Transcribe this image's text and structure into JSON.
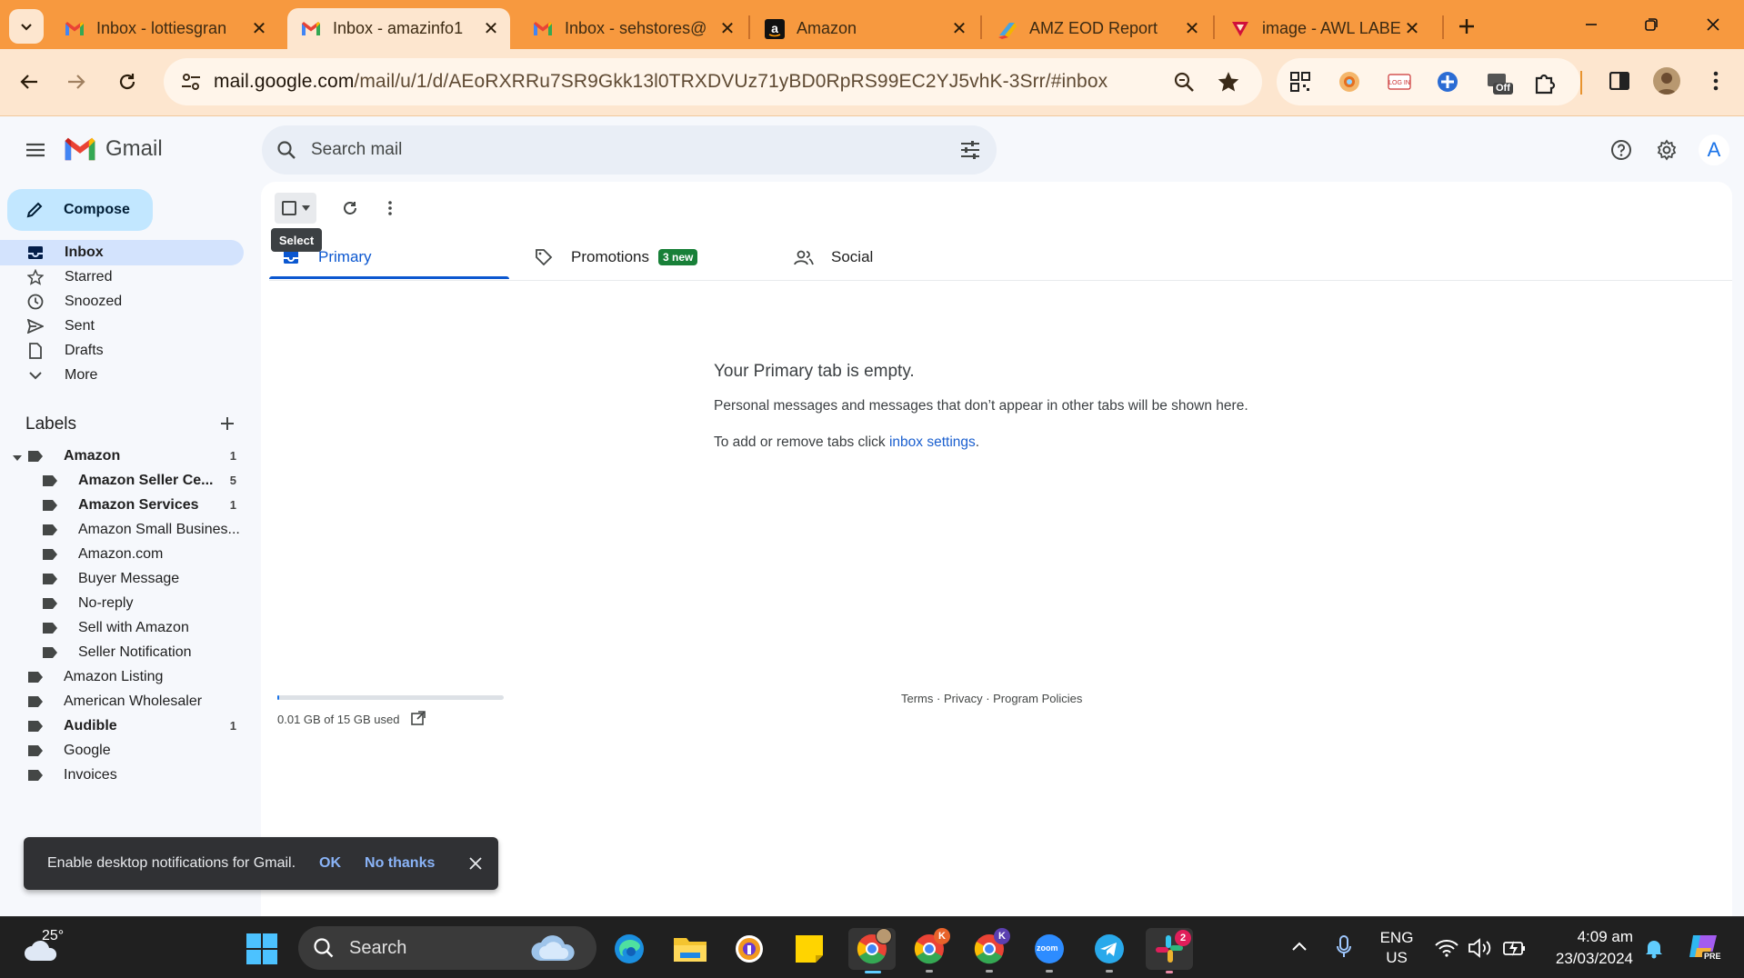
{
  "browser": {
    "tabs": [
      {
        "title": "Inbox - lottiesgran",
        "favicon": "gmail-icon"
      },
      {
        "title": "Inbox - amazinfo1",
        "favicon": "gmail-icon",
        "active": true
      },
      {
        "title": "Inbox - sehstores@",
        "favicon": "gmail-icon"
      },
      {
        "title": "Amazon",
        "favicon": "amazon-icon"
      },
      {
        "title": "AMZ EOD Report",
        "favicon": "report-icon"
      },
      {
        "title": "image - AWL LABE",
        "favicon": "image-icon"
      }
    ],
    "url_host": "mail.google.com",
    "url_path": "/mail/u/1/d/AEoRXRRu7SR9Gkk13l0TRXDVUz71yBD0RpRS99EC2YJ5vhK-3Srr/#inbox",
    "ext_badge": "Off",
    "accent_color": "#f7993f"
  },
  "gmail": {
    "logo_text": "Gmail",
    "search_placeholder": "Search mail",
    "compose_label": "Compose",
    "avatar_initial": "A",
    "nav": [
      {
        "label": "Inbox",
        "icon": "inbox-icon"
      },
      {
        "label": "Starred",
        "icon": "star-icon"
      },
      {
        "label": "Snoozed",
        "icon": "clock-icon"
      },
      {
        "label": "Sent",
        "icon": "send-icon"
      },
      {
        "label": "Drafts",
        "icon": "draft-icon"
      },
      {
        "label": "More",
        "icon": "chevron-down-icon"
      }
    ],
    "labels_heading": "Labels",
    "labels": [
      {
        "name": "Amazon",
        "count": "1",
        "bold": true,
        "indent": 0
      },
      {
        "name": "Amazon Seller Ce...",
        "count": "5",
        "bold": true,
        "indent": 1
      },
      {
        "name": "Amazon Services",
        "count": "1",
        "bold": true,
        "indent": 1
      },
      {
        "name": "Amazon Small Busines...",
        "count": "",
        "bold": false,
        "indent": 1
      },
      {
        "name": "Amazon.com",
        "count": "",
        "bold": false,
        "indent": 1
      },
      {
        "name": "Buyer Message",
        "count": "",
        "bold": false,
        "indent": 1
      },
      {
        "name": "No-reply",
        "count": "",
        "bold": false,
        "indent": 1
      },
      {
        "name": "Sell with Amazon",
        "count": "",
        "bold": false,
        "indent": 1
      },
      {
        "name": "Seller Notification",
        "count": "",
        "bold": false,
        "indent": 1
      },
      {
        "name": "Amazon Listing",
        "count": "",
        "bold": false,
        "indent": 0
      },
      {
        "name": "American Wholesaler",
        "count": "",
        "bold": false,
        "indent": 0
      },
      {
        "name": "Audible",
        "count": "1",
        "bold": true,
        "indent": 0
      },
      {
        "name": "Google",
        "count": "",
        "bold": false,
        "indent": 0
      },
      {
        "name": "Invoices",
        "count": "",
        "bold": false,
        "indent": 0
      }
    ],
    "select_tooltip": "Select",
    "category_tabs": [
      {
        "label": "Primary",
        "icon": "inbox-icon"
      },
      {
        "label": "Promotions",
        "icon": "tag-icon",
        "badge": "3 new"
      },
      {
        "label": "Social",
        "icon": "people-icon"
      }
    ],
    "empty": {
      "title": "Your Primary tab is empty.",
      "description": "Personal messages and messages that don’t appear in other tabs will be shown here.",
      "settings_prefix": "To add or remove tabs click ",
      "settings_link": "inbox settings",
      "settings_suffix": "."
    },
    "storage": {
      "text": "0.01 GB of 15 GB used",
      "used_fraction": 0.0007
    },
    "footer": {
      "terms": "Terms",
      "privacy": "Privacy",
      "policies": "Program Policies",
      "sep": " · "
    },
    "snackbar": {
      "message": "Enable desktop notifications for Gmail.",
      "ok": "OK",
      "no_thanks": "No thanks"
    }
  },
  "taskbar": {
    "weather_temp": "25°",
    "search_label": "Search",
    "lang_primary": "ENG",
    "lang_secondary": "US",
    "time": "4:09 am",
    "date": "23/03/2024",
    "chrome_badge_k1": "K",
    "chrome_badge_k2": "K",
    "slack_badge": "2",
    "zoom_label": "zoom",
    "copilot_badge": "PRE"
  }
}
